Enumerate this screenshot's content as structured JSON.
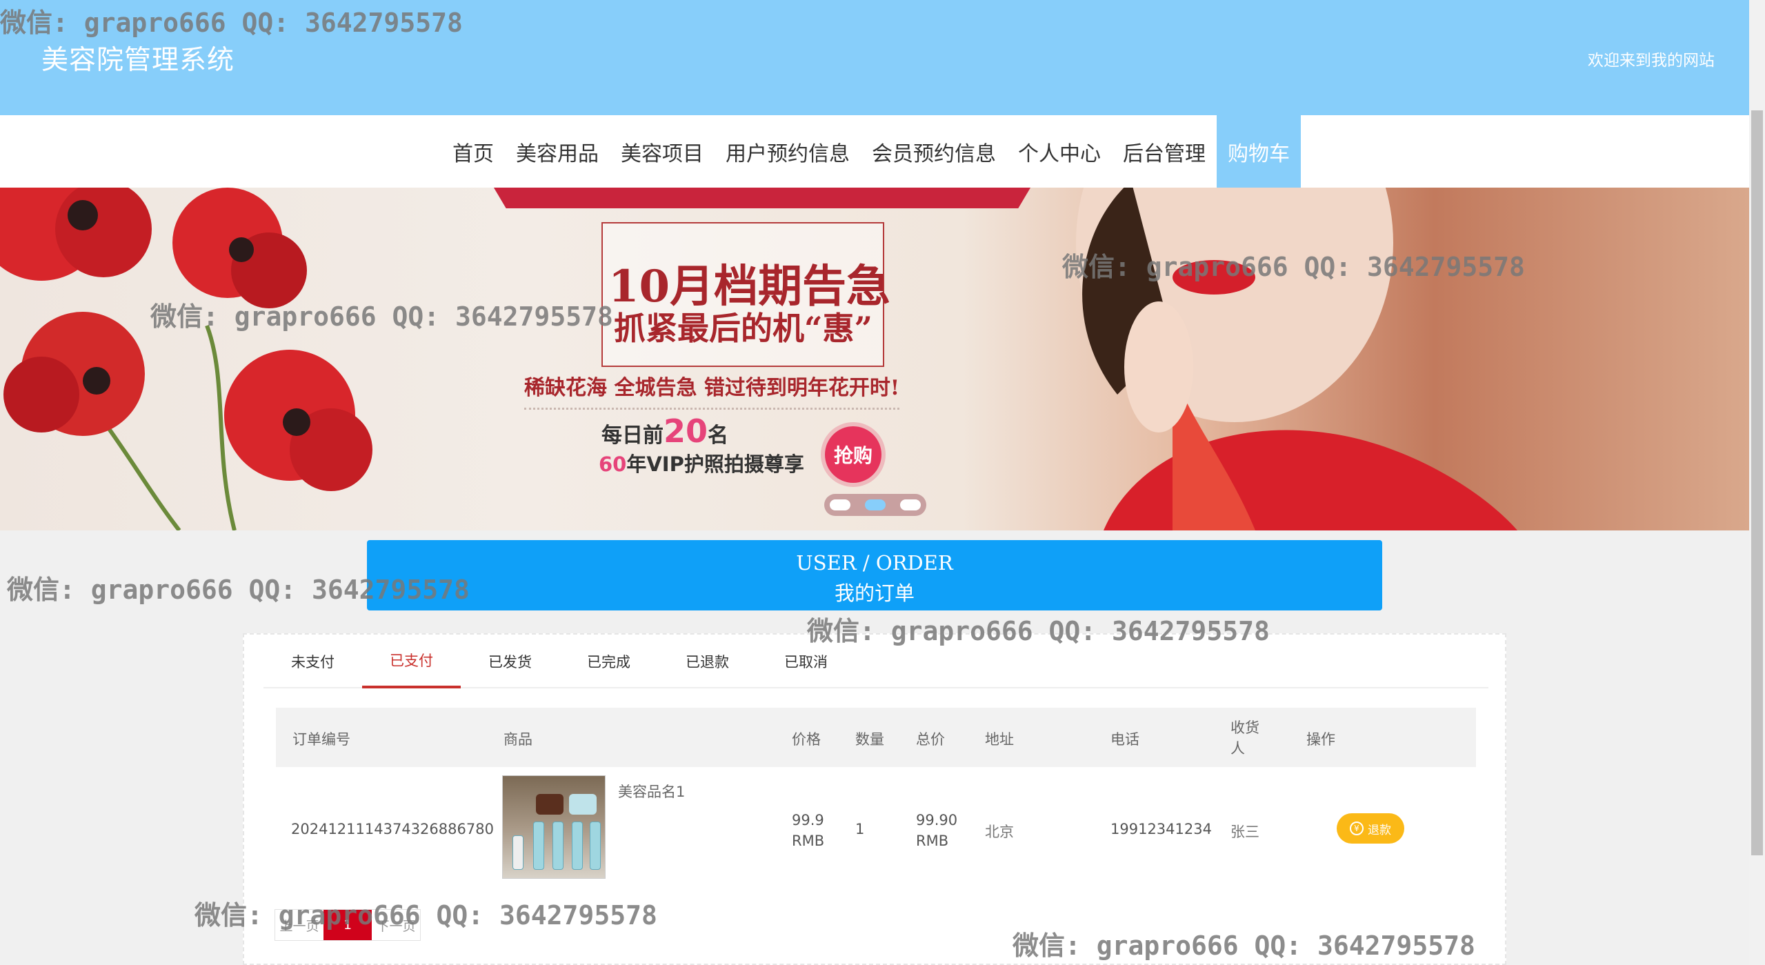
{
  "header": {
    "site_title": "美容院管理系统",
    "welcome": "欢迎来到我的网站"
  },
  "nav": {
    "items": [
      {
        "label": "首页"
      },
      {
        "label": "美容用品"
      },
      {
        "label": "美容项目"
      },
      {
        "label": "用户预约信息"
      },
      {
        "label": "会员预约信息"
      },
      {
        "label": "个人中心"
      },
      {
        "label": "后台管理"
      },
      {
        "label": "购物车"
      }
    ],
    "active": "购物车"
  },
  "banner": {
    "title": "10月档期告急",
    "subtitle": "抓紧最后的机“惠”",
    "line": "稀缺花海 全城告急 错过待到明年花开时!",
    "daily_prefix": "每日前",
    "daily_number": "20",
    "daily_suffix": "名",
    "vip_number": "60",
    "vip_text": "年VIP护照拍摄尊享",
    "grab": "抢购"
  },
  "order_header": {
    "en": "USER / ORDER",
    "zh": "我的订单"
  },
  "tabs": [
    {
      "label": "未支付"
    },
    {
      "label": "已支付"
    },
    {
      "label": "已发货"
    },
    {
      "label": "已完成"
    },
    {
      "label": "已退款"
    },
    {
      "label": "已取消"
    }
  ],
  "active_tab": "已支付",
  "table": {
    "headers": {
      "order_no": "订单编号",
      "product": "商品",
      "price": "价格",
      "qty": "数量",
      "total": "总价",
      "address": "地址",
      "phone": "电话",
      "receiver": "收货人",
      "action": "操作"
    },
    "rows": [
      {
        "order_no": "20241211143743268867​80",
        "product_name": "美容品名1",
        "price": "99.9",
        "price_unit": "RMB",
        "qty": "1",
        "total": "99.90",
        "total_unit": "RMB",
        "address": "北京",
        "phone": "19912341234",
        "receiver": "张三",
        "action": "退款"
      }
    ]
  },
  "pager": {
    "prev": "上一页",
    "current": "1",
    "next": "下一页"
  },
  "watermark": "微信: grapro666 QQ: 3642795578"
}
